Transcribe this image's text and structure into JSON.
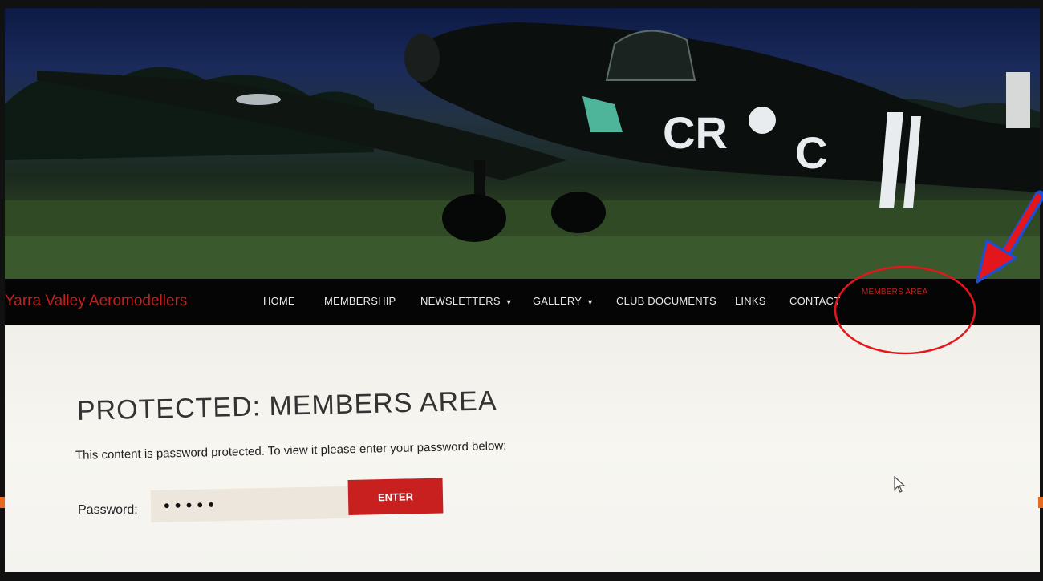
{
  "site": {
    "brand": "Yarra Valley Aeromodellers",
    "hero_marking_left": "CR",
    "hero_marking_right": "C"
  },
  "nav": {
    "items": [
      {
        "label": "HOME",
        "dropdown": false
      },
      {
        "label": "MEMBERSHIP",
        "dropdown": false
      },
      {
        "label": "NEWSLETTERS",
        "dropdown": true
      },
      {
        "label": "GALLERY",
        "dropdown": true
      },
      {
        "label": "CLUB DOCUMENTS",
        "dropdown": false
      },
      {
        "label": "LINKS",
        "dropdown": false
      },
      {
        "label": "CONTACT",
        "dropdown": false
      },
      {
        "label": "MEMBERS AREA",
        "dropdown": false,
        "active": true
      }
    ],
    "caret_glyph": "▼"
  },
  "page": {
    "title": "PROTECTED: MEMBERS AREA",
    "notice": "This content is password protected. To view it please enter your password below:",
    "password_label": "Password:",
    "password_value": "•••••",
    "enter_label": "ENTER"
  },
  "icons": {
    "cursor": "mouse-pointer-icon",
    "arrow": "red-arrow-annotation-icon",
    "circle": "red-circle-annotation-icon"
  },
  "colors": {
    "brand": "#c0211f",
    "nav_bg": "#050505",
    "button": "#c8201e",
    "annotation": "#e3161b",
    "accent_orange": "#e66a1f"
  }
}
